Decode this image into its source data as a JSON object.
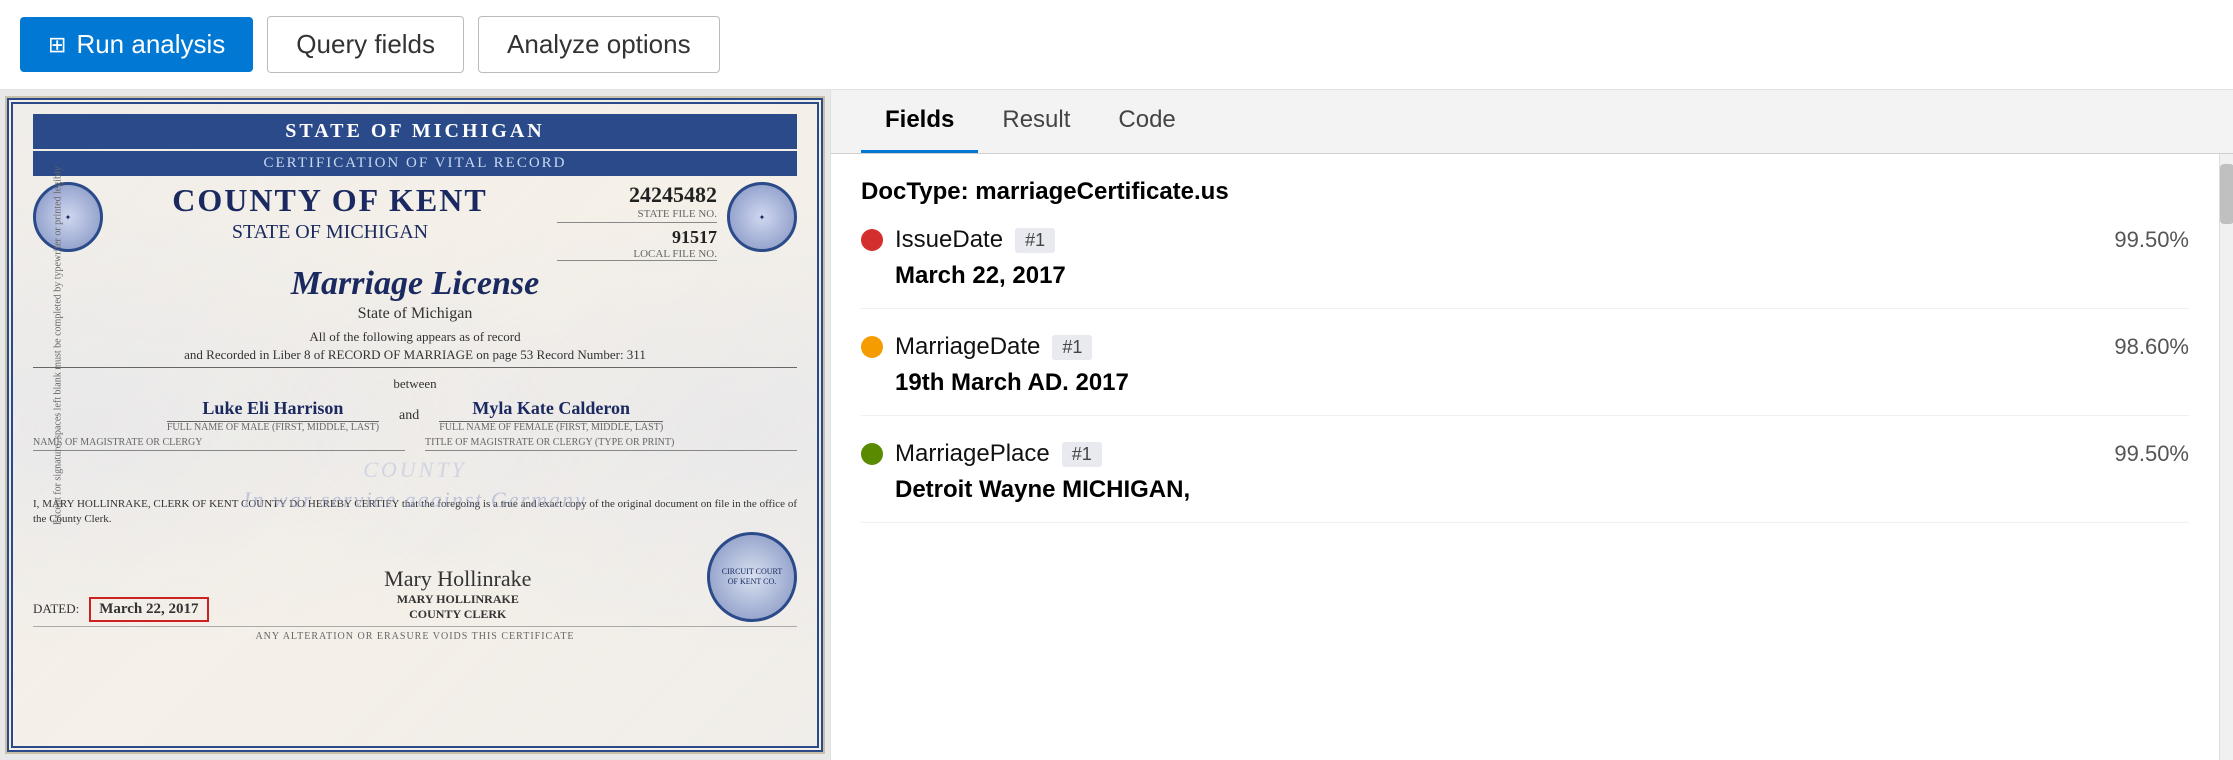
{
  "toolbar": {
    "run_label": "Run analysis",
    "query_fields_label": "Query fields",
    "analyze_options_label": "Analyze options"
  },
  "image": {
    "cert": {
      "header": "STATE OF MICHIGAN",
      "subheader": "CERTIFICATION OF VITAL RECORD",
      "county": "COUNTY OF KENT",
      "state": "STATE OF MICHIGAN",
      "file_no_label": "STATE FILE NO.",
      "file_no_value": "24245482",
      "local_file_label": "LOCAL FILE NO.",
      "local_file_value": "91517",
      "title": "Marriage License",
      "subtitle": "State of Michigan",
      "body1": "All of the following appears as of record",
      "recorded_line": "and Recorded in Liber 8 of RECORD OF MARRIAGE on page 53 Record Number: 311",
      "between": "between",
      "groom_name": "Luke Eli Harrison",
      "groom_label": "FULL NAME OF MALE (FIRST, MIDDLE, LAST)",
      "and": "and",
      "bride_name": "Myla Kate Calderon",
      "bride_label": "FULL NAME OF FEMALE (FIRST, MIDDLE, LAST)",
      "magistrate_label1": "NAME OF MAGISTRATE OR CLERGY",
      "magistrate_label2": "TITLE OF MAGISTRATE OR CLERGY (TYPE OR PRINT)",
      "watermark": "COUNTY",
      "war_text": "In war service against Germany",
      "certify_text": "I, MARY HOLLINRAKE, CLERK OF KENT COUNTY DO HEREBY CERTIFY that the foregoing is a true and exact copy of the original document on file in the office of the County Clerk.",
      "dated_label": "DATED:",
      "date_value": "March 22, 2017",
      "sig_name": "Mary Hollinrake",
      "sig_title1": "MARY HOLLINRAKE",
      "sig_title2": "COUNTY CLERK",
      "footer": "ANY ALTERATION OR ERASURE VOIDS THIS CERTIFICATE"
    }
  },
  "right_panel": {
    "tabs": [
      {
        "id": "fields",
        "label": "Fields",
        "active": true
      },
      {
        "id": "result",
        "label": "Result",
        "active": false
      },
      {
        "id": "code",
        "label": "Code",
        "active": false
      }
    ],
    "doctype_label": "DocType:",
    "doctype_value": "marriageCertificate.us",
    "fields": [
      {
        "name": "IssueDate",
        "badge": "#1",
        "dot_color": "#d32f2f",
        "confidence": "99.50%",
        "value": "March 22, 2017"
      },
      {
        "name": "MarriageDate",
        "badge": "#1",
        "dot_color": "#f59d00",
        "confidence": "98.60%",
        "value": "19th March AD. 2017"
      },
      {
        "name": "MarriagePlace",
        "badge": "#1",
        "dot_color": "#5a8a00",
        "confidence": "99.50%",
        "value": "Detroit Wayne MICHIGAN,"
      }
    ]
  },
  "icons": {
    "run_icon": "▦",
    "eye_icon": "👁",
    "chevron_down": "⌄"
  }
}
